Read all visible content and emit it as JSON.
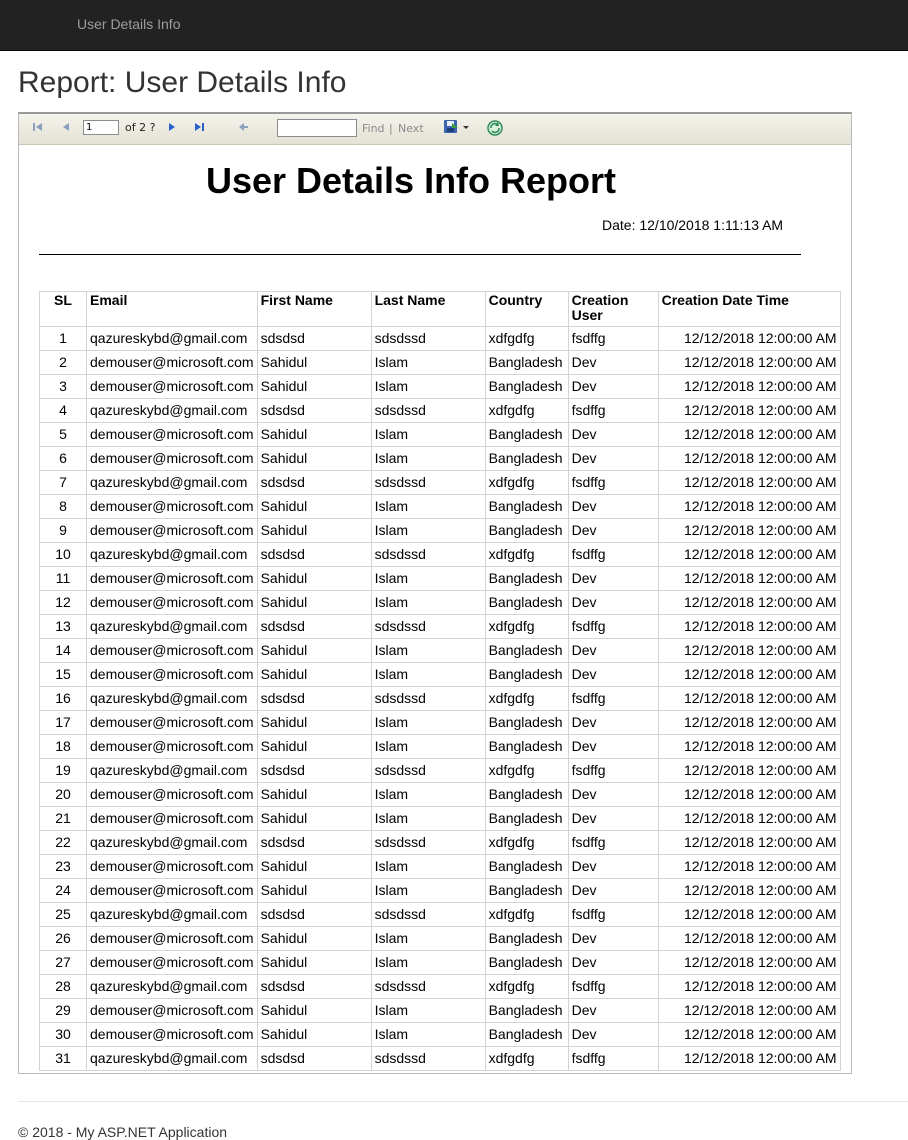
{
  "navbar": {
    "brand": "User Details Info"
  },
  "page": {
    "title": "Report: User Details Info"
  },
  "toolbar": {
    "page_number": "1",
    "of_label": "of 2 ?",
    "find_label": "Find",
    "separator": "|",
    "next_label": "Next",
    "find_value": ""
  },
  "report": {
    "title": "User Details Info Report",
    "date": "Date: 12/10/2018 1:11:13 AM",
    "columns": [
      "SL",
      "Email",
      "First Name",
      "Last Name",
      "Country",
      "Creation User",
      "Creation Date Time"
    ],
    "rows": [
      [
        "1",
        "qazureskybd@gmail.com",
        "sdsdsd",
        "sdsdssd",
        "xdfgdfg",
        "fsdffg",
        "12/12/2018 12:00:00 AM"
      ],
      [
        "2",
        "demouser@microsoft.com",
        "Sahidul",
        "Islam",
        "Bangladesh",
        "Dev",
        "12/12/2018 12:00:00 AM"
      ],
      [
        "3",
        "demouser@microsoft.com",
        "Sahidul",
        "Islam",
        "Bangladesh",
        "Dev",
        "12/12/2018 12:00:00 AM"
      ],
      [
        "4",
        "qazureskybd@gmail.com",
        "sdsdsd",
        "sdsdssd",
        "xdfgdfg",
        "fsdffg",
        "12/12/2018 12:00:00 AM"
      ],
      [
        "5",
        "demouser@microsoft.com",
        "Sahidul",
        "Islam",
        "Bangladesh",
        "Dev",
        "12/12/2018 12:00:00 AM"
      ],
      [
        "6",
        "demouser@microsoft.com",
        "Sahidul",
        "Islam",
        "Bangladesh",
        "Dev",
        "12/12/2018 12:00:00 AM"
      ],
      [
        "7",
        "qazureskybd@gmail.com",
        "sdsdsd",
        "sdsdssd",
        "xdfgdfg",
        "fsdffg",
        "12/12/2018 12:00:00 AM"
      ],
      [
        "8",
        "demouser@microsoft.com",
        "Sahidul",
        "Islam",
        "Bangladesh",
        "Dev",
        "12/12/2018 12:00:00 AM"
      ],
      [
        "9",
        "demouser@microsoft.com",
        "Sahidul",
        "Islam",
        "Bangladesh",
        "Dev",
        "12/12/2018 12:00:00 AM"
      ],
      [
        "10",
        "qazureskybd@gmail.com",
        "sdsdsd",
        "sdsdssd",
        "xdfgdfg",
        "fsdffg",
        "12/12/2018 12:00:00 AM"
      ],
      [
        "11",
        "demouser@microsoft.com",
        "Sahidul",
        "Islam",
        "Bangladesh",
        "Dev",
        "12/12/2018 12:00:00 AM"
      ],
      [
        "12",
        "demouser@microsoft.com",
        "Sahidul",
        "Islam",
        "Bangladesh",
        "Dev",
        "12/12/2018 12:00:00 AM"
      ],
      [
        "13",
        "qazureskybd@gmail.com",
        "sdsdsd",
        "sdsdssd",
        "xdfgdfg",
        "fsdffg",
        "12/12/2018 12:00:00 AM"
      ],
      [
        "14",
        "demouser@microsoft.com",
        "Sahidul",
        "Islam",
        "Bangladesh",
        "Dev",
        "12/12/2018 12:00:00 AM"
      ],
      [
        "15",
        "demouser@microsoft.com",
        "Sahidul",
        "Islam",
        "Bangladesh",
        "Dev",
        "12/12/2018 12:00:00 AM"
      ],
      [
        "16",
        "qazureskybd@gmail.com",
        "sdsdsd",
        "sdsdssd",
        "xdfgdfg",
        "fsdffg",
        "12/12/2018 12:00:00 AM"
      ],
      [
        "17",
        "demouser@microsoft.com",
        "Sahidul",
        "Islam",
        "Bangladesh",
        "Dev",
        "12/12/2018 12:00:00 AM"
      ],
      [
        "18",
        "demouser@microsoft.com",
        "Sahidul",
        "Islam",
        "Bangladesh",
        "Dev",
        "12/12/2018 12:00:00 AM"
      ],
      [
        "19",
        "qazureskybd@gmail.com",
        "sdsdsd",
        "sdsdssd",
        "xdfgdfg",
        "fsdffg",
        "12/12/2018 12:00:00 AM"
      ],
      [
        "20",
        "demouser@microsoft.com",
        "Sahidul",
        "Islam",
        "Bangladesh",
        "Dev",
        "12/12/2018 12:00:00 AM"
      ],
      [
        "21",
        "demouser@microsoft.com",
        "Sahidul",
        "Islam",
        "Bangladesh",
        "Dev",
        "12/12/2018 12:00:00 AM"
      ],
      [
        "22",
        "qazureskybd@gmail.com",
        "sdsdsd",
        "sdsdssd",
        "xdfgdfg",
        "fsdffg",
        "12/12/2018 12:00:00 AM"
      ],
      [
        "23",
        "demouser@microsoft.com",
        "Sahidul",
        "Islam",
        "Bangladesh",
        "Dev",
        "12/12/2018 12:00:00 AM"
      ],
      [
        "24",
        "demouser@microsoft.com",
        "Sahidul",
        "Islam",
        "Bangladesh",
        "Dev",
        "12/12/2018 12:00:00 AM"
      ],
      [
        "25",
        "qazureskybd@gmail.com",
        "sdsdsd",
        "sdsdssd",
        "xdfgdfg",
        "fsdffg",
        "12/12/2018 12:00:00 AM"
      ],
      [
        "26",
        "demouser@microsoft.com",
        "Sahidul",
        "Islam",
        "Bangladesh",
        "Dev",
        "12/12/2018 12:00:00 AM"
      ],
      [
        "27",
        "demouser@microsoft.com",
        "Sahidul",
        "Islam",
        "Bangladesh",
        "Dev",
        "12/12/2018 12:00:00 AM"
      ],
      [
        "28",
        "qazureskybd@gmail.com",
        "sdsdsd",
        "sdsdssd",
        "xdfgdfg",
        "fsdffg",
        "12/12/2018 12:00:00 AM"
      ],
      [
        "29",
        "demouser@microsoft.com",
        "Sahidul",
        "Islam",
        "Bangladesh",
        "Dev",
        "12/12/2018 12:00:00 AM"
      ],
      [
        "30",
        "demouser@microsoft.com",
        "Sahidul",
        "Islam",
        "Bangladesh",
        "Dev",
        "12/12/2018 12:00:00 AM"
      ],
      [
        "31",
        "qazureskybd@gmail.com",
        "sdsdsd",
        "sdsdssd",
        "xdfgdfg",
        "fsdffg",
        "12/12/2018 12:00:00 AM"
      ]
    ]
  },
  "footer": {
    "text": "© 2018 - My ASP.NET Application"
  }
}
